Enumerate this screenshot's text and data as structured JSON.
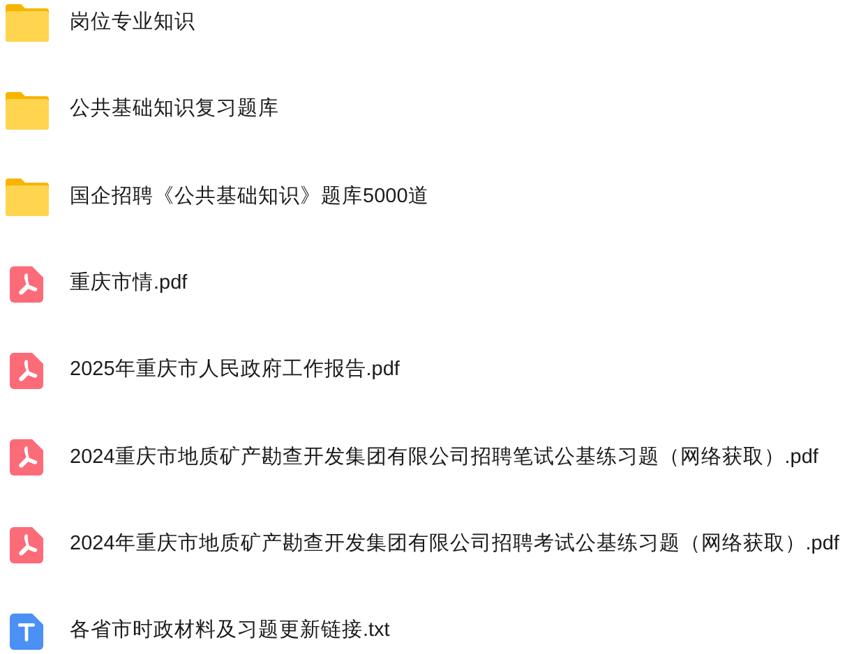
{
  "files": [
    {
      "kind": "folder",
      "name": "岗位专业知识"
    },
    {
      "kind": "folder",
      "name": "公共基础知识复习题库"
    },
    {
      "kind": "folder",
      "name": "国企招聘《公共基础知识》题库5000道"
    },
    {
      "kind": "pdf",
      "name": "重庆市情.pdf"
    },
    {
      "kind": "pdf",
      "name": "2025年重庆市人民政府工作报告.pdf"
    },
    {
      "kind": "pdf",
      "name": "2024重庆市地质矿产勘查开发集团有限公司招聘笔试公基练习题（网络获取）.pdf"
    },
    {
      "kind": "pdf",
      "name": "2024年重庆市地质矿产勘查开发集团有限公司招聘考试公基练习题（网络获取）.pdf"
    },
    {
      "kind": "txt",
      "name": "各省市时政材料及习题更新链接.txt"
    }
  ]
}
